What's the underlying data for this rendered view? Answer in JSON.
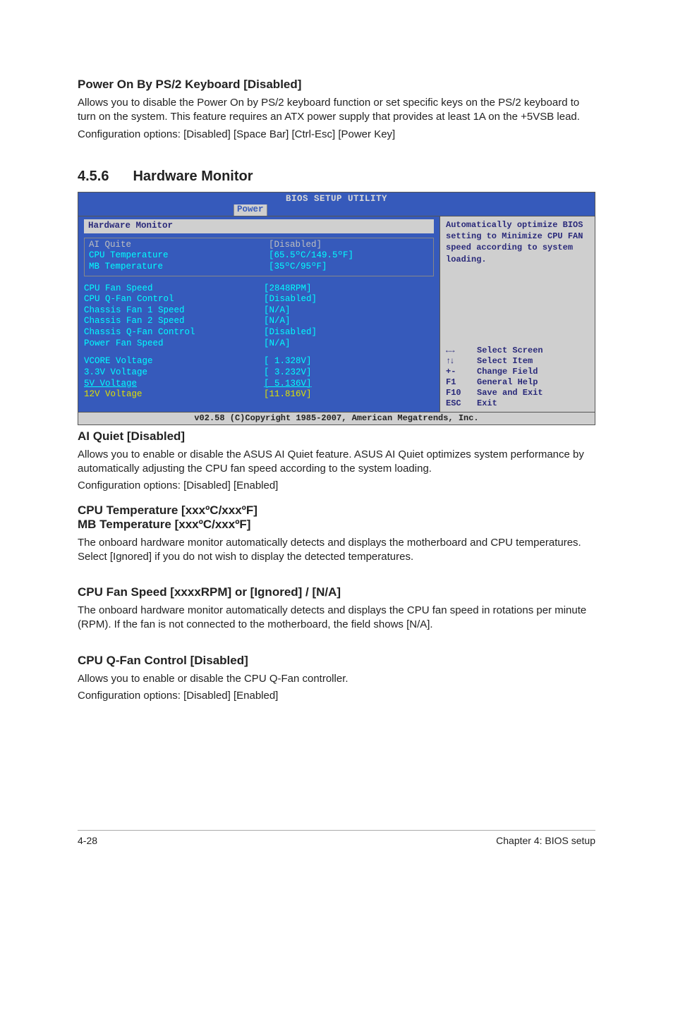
{
  "h1": {
    "title": "Power On By PS/2 Keyboard [Disabled]",
    "p1": "Allows you to disable the Power On by PS/2 keyboard function or set specific keys on the PS/2 keyboard to turn on the system. This feature requires an ATX power supply that provides at least 1A on the +5VSB lead.",
    "p2": "Configuration options: [Disabled] [Space Bar] [Ctrl-Esc] [Power Key]"
  },
  "h2": {
    "num": "4.5.6",
    "title": "Hardware Monitor"
  },
  "bios": {
    "title": "BIOS SETUP UTILITY",
    "tab": "Power",
    "panel_title": "Hardware Monitor",
    "sel": [
      {
        "label": "AI Quite",
        "value": "[Disabled]"
      },
      {
        "label": "CPU Temperature",
        "value": "[65.5ºC/149.5ºF]"
      },
      {
        "label": "MB Temperature",
        "value": "[35ºC/95ºF]"
      }
    ],
    "items": [
      {
        "label": "CPU Fan Speed",
        "value": "[2848RPM]"
      },
      {
        "label": "CPU Q-Fan Control",
        "value": "[Disabled]"
      },
      {
        "label": "Chassis Fan 1 Speed",
        "value": "[N/A]"
      },
      {
        "label": "Chassis Fan 2 Speed",
        "value": "[N/A]"
      },
      {
        "label": "Chassis Q-Fan Control",
        "value": "[Disabled]"
      },
      {
        "label": "Power Fan Speed",
        "value": "[N/A]"
      }
    ],
    "volts": [
      {
        "label": "VCORE Voltage",
        "value": "[ 1.328V]"
      },
      {
        "label": "3.3V  Voltage",
        "value": "[ 3.232V]"
      },
      {
        "label": "5V    Voltage",
        "value": "[ 5.136V]",
        "ul": true
      },
      {
        "label": "12V   Voltage",
        "value": "[11.816V]"
      }
    ],
    "help": "Automatically optimize BIOS setting to Minimize  CPU FAN speed according to system loading.",
    "nav": [
      {
        "k": "←→",
        "t": "Select Screen"
      },
      {
        "k": "↑↓",
        "t": "Select Item"
      },
      {
        "k": "+-",
        "t": "Change Field"
      },
      {
        "k": "F1",
        "t": "General Help"
      },
      {
        "k": "F10",
        "t": "Save and Exit"
      },
      {
        "k": "ESC",
        "t": "Exit"
      }
    ],
    "footer": "v02.58 (C)Copyright 1985-2007, American Megatrends, Inc."
  },
  "h3": {
    "title": "AI Quiet [Disabled]",
    "p1": "Allows you to enable or disable the ASUS AI Quiet feature. ASUS AI Quiet optimizes system performance by automatically adjusting the CPU fan speed according to the system loading.",
    "p2": "Configuration options: [Disabled] [Enabled]"
  },
  "h4": {
    "title1": "CPU Temperature [xxxºC/xxxºF]",
    "title2": "MB Temperature [xxxºC/xxxºF]",
    "p1": "The onboard hardware monitor automatically detects and displays the motherboard and CPU temperatures. Select [Ignored] if you do not wish to display the detected temperatures."
  },
  "h5": {
    "title": "CPU Fan Speed [xxxxRPM] or [Ignored] / [N/A]",
    "p1": "The onboard hardware monitor automatically detects and displays the CPU fan speed in rotations per minute (RPM). If the fan is not connected to the motherboard, the field shows [N/A]."
  },
  "h6": {
    "title": "CPU Q-Fan Control [Disabled]",
    "p1": "Allows you to enable or disable the CPU Q-Fan controller.",
    "p2": "Configuration options: [Disabled] [Enabled]"
  },
  "footer": {
    "left": "4-28",
    "right": "Chapter 4: BIOS setup"
  }
}
